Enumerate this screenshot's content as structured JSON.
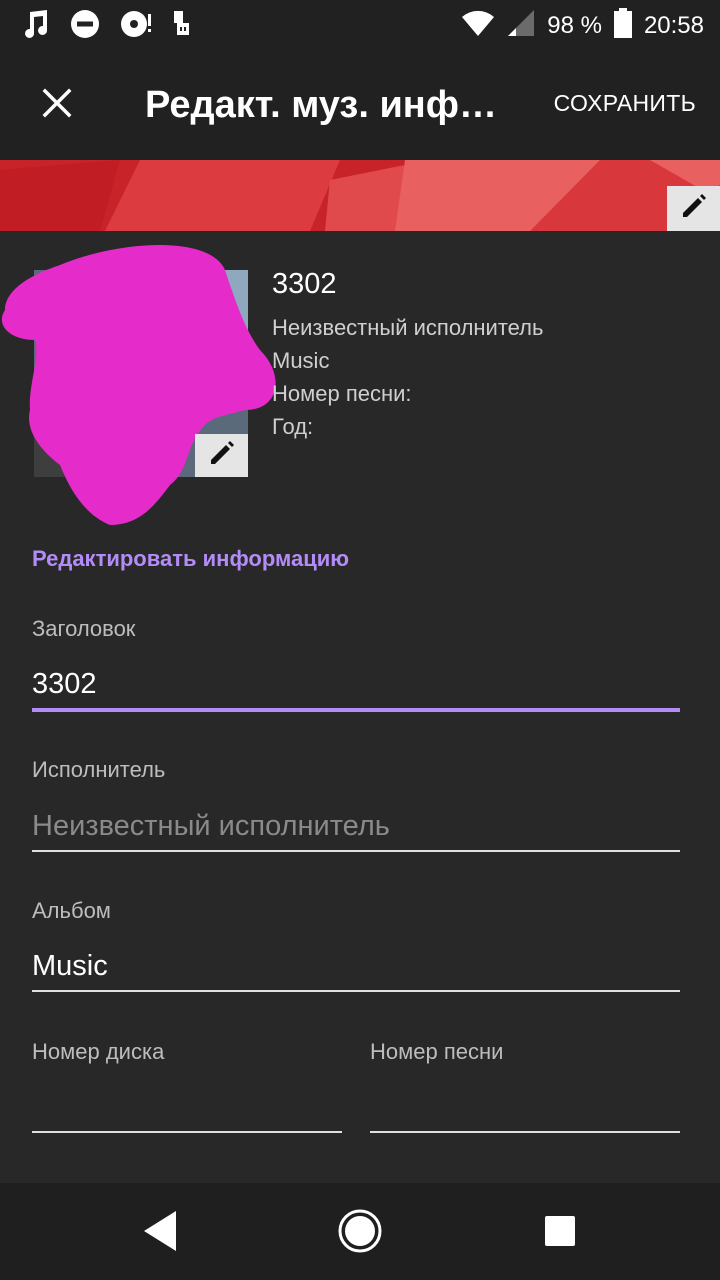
{
  "status_bar": {
    "battery_percent": "98 %",
    "time": "20:58",
    "icons": [
      "music-note-icon",
      "do-not-disturb-icon",
      "media-icon",
      "usb-icon",
      "wifi-icon",
      "signal-icon",
      "battery-icon"
    ]
  },
  "app_bar": {
    "title": "Редакт. муз. инф…",
    "save_label": "СОХРАНИТЬ"
  },
  "track_info": {
    "title": "3302",
    "artist": "Неизвестный исполнитель",
    "album": "Music",
    "track_number_label": "Номер песни:",
    "year_label": "Год:"
  },
  "section": {
    "edit_info_label": "Редактировать информацию"
  },
  "form": {
    "title_label": "Заголовок",
    "title_value": "3302",
    "artist_label": "Исполнитель",
    "artist_placeholder": "Неизвестный исполнитель",
    "album_label": "Альбом",
    "album_value": "Music",
    "disc_label": "Номер диска",
    "disc_value": "",
    "track_label": "Номер песни",
    "track_value": ""
  },
  "colors": {
    "accent": "#b38cf7",
    "banner": "#c9232a",
    "background": "#282828",
    "toolbar": "#212121"
  }
}
